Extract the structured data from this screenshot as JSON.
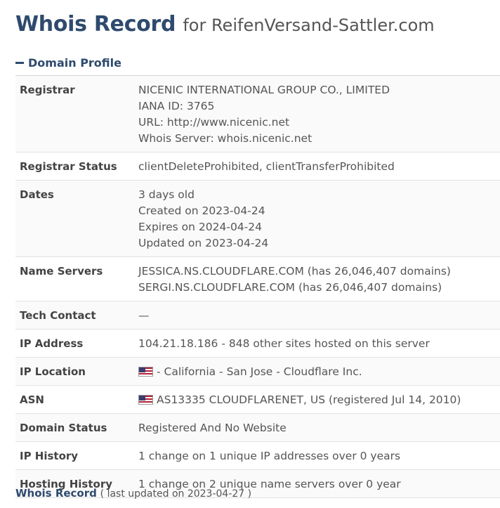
{
  "header": {
    "title_main": "Whois Record",
    "title_sub": "for ReifenVersand-Sattler.com"
  },
  "section": {
    "label": "Domain Profile"
  },
  "rows": [
    {
      "key": "Registrar",
      "lines": [
        "NICENIC INTERNATIONAL GROUP CO., LIMITED",
        "IANA ID: 3765",
        "URL: http://www.nicenic.net",
        "Whois Server: whois.nicenic.net"
      ]
    },
    {
      "key": "Registrar Status",
      "lines": [
        "clientDeleteProhibited, clientTransferProhibited"
      ]
    },
    {
      "key": "Dates",
      "lines": [
        "3 days old",
        "Created on 2023-04-24",
        "Expires on 2024-04-24",
        "Updated on 2023-04-24"
      ]
    },
    {
      "key": "Name Servers",
      "lines": [
        "JESSICA.NS.CLOUDFLARE.COM (has 26,046,407 domains)",
        "SERGI.NS.CLOUDFLARE.COM (has 26,046,407 domains)"
      ]
    },
    {
      "key": "Tech Contact",
      "lines": [
        "—"
      ]
    },
    {
      "key": "IP Address",
      "lines": [
        "104.21.18.186 - 848 other sites hosted on this server"
      ]
    },
    {
      "key": "IP Location",
      "lines": [
        "- California - San Jose - Cloudflare Inc."
      ],
      "flag": true
    },
    {
      "key": "ASN",
      "lines": [
        "AS13335 CLOUDFLARENET, US (registered Jul 14, 2010)"
      ],
      "flag": true
    },
    {
      "key": "Domain Status",
      "lines": [
        "Registered And No Website"
      ]
    },
    {
      "key": "IP History",
      "lines": [
        "1 change on 1 unique IP addresses over 0 years"
      ]
    },
    {
      "key": "Hosting History",
      "lines": [
        "1 change on 2 unique name servers over 0 year"
      ]
    }
  ],
  "footer": {
    "link": "Whois Record",
    "meta": "( last updated on 2023-04-27 )"
  }
}
